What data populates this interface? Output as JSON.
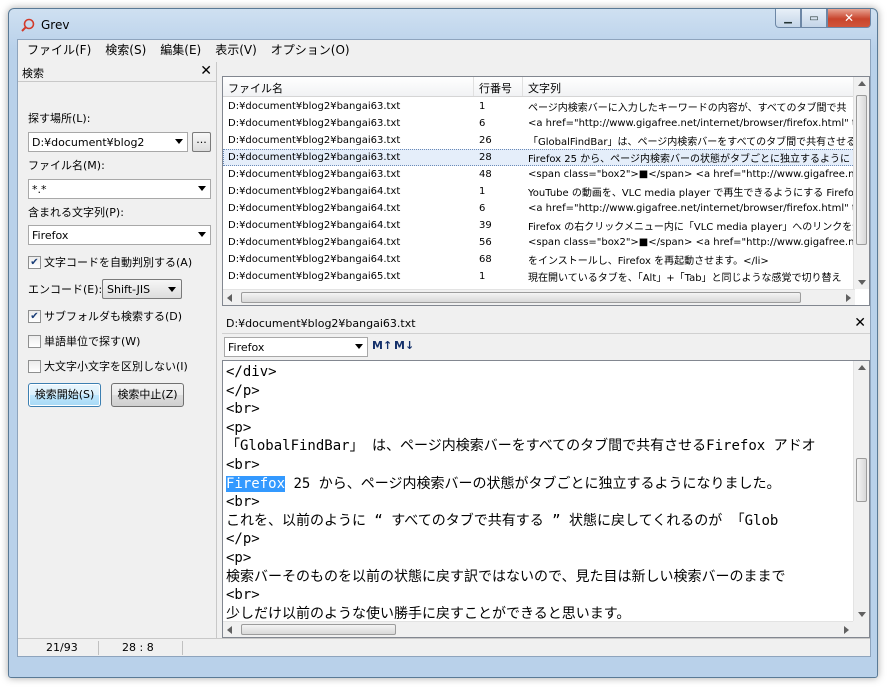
{
  "window": {
    "title": "Grev"
  },
  "menu": [
    "ファイル(F)",
    "検索(S)",
    "編集(E)",
    "表示(V)",
    "オプション(O)"
  ],
  "search_panel": {
    "title": "検索",
    "location_label": "探す場所(L):",
    "location_value": "D:¥document¥blog2",
    "browse_label": "...",
    "filename_label": "ファイル名(M):",
    "filename_value": "*.*",
    "text_label": "含まれる文字列(P):",
    "text_value": "Firefox",
    "autodetect_label": "文字コードを自動判別する(A)",
    "autodetect_checked": true,
    "encoding_label": "エンコード(E):",
    "encoding_value": "Shift-JIS",
    "subfolders_label": "サブフォルダも検索する(D)",
    "subfolders_checked": true,
    "wholeword_label": "単語単位で探す(W)",
    "wholeword_checked": false,
    "case_label": "大文字小文字を区別しない(I)",
    "case_checked": false,
    "start_button": "検索開始(S)",
    "stop_button": "検索中止(Z)"
  },
  "results": {
    "columns": [
      "ファイル名",
      "行番号",
      "文字列"
    ],
    "rows": [
      {
        "file": "D:¥document¥blog2¥bangai63.txt",
        "line": "1",
        "text": "ページ内検索バーに入力したキーワードの内容が、すべてのタブ間で共"
      },
      {
        "file": "D:¥document¥blog2¥bangai63.txt",
        "line": "6",
        "text": "<a href=\"http://www.gigafree.net/internet/browser/firefox.html\" t"
      },
      {
        "file": "D:¥document¥blog2¥bangai63.txt",
        "line": "26",
        "text": "「GlobalFindBar」は、ページ内検索バーをすべてのタブ間で共有させる"
      },
      {
        "file": "D:¥document¥blog2¥bangai63.txt",
        "line": "28",
        "text": "Firefox 25 から、ページ内検索バーの状態がタブごとに独立するように"
      },
      {
        "file": "D:¥document¥blog2¥bangai63.txt",
        "line": "48",
        "text": "<span class=\"box2\">■</span>  <a href=\"http://www.gigafree.n"
      },
      {
        "file": "D:¥document¥blog2¥bangai64.txt",
        "line": "1",
        "text": "YouTube の動画を、VLC media player で再生できるようにする Firefox"
      },
      {
        "file": "D:¥document¥blog2¥bangai64.txt",
        "line": "6",
        "text": "<a href=\"http://www.gigafree.net/internet/browser/firefox.html\" t"
      },
      {
        "file": "D:¥document¥blog2¥bangai64.txt",
        "line": "39",
        "text": "Firefox の右クリックメニュー内に「VLC media player」へのリンクを追加"
      },
      {
        "file": "D:¥document¥blog2¥bangai64.txt",
        "line": "56",
        "text": "<span class=\"box2\">■</span>  <a href=\"http://www.gigafree.n"
      },
      {
        "file": "D:¥document¥blog2¥bangai64.txt",
        "line": "68",
        "text": "をインストールし、Firefox を再起動させます。</li>"
      },
      {
        "file": "D:¥document¥blog2¥bangai65.txt",
        "line": "1",
        "text": "現在開いているタブを、「Alt」+「Tab」と同じような感覚で切り替え"
      }
    ],
    "selected_row": 3
  },
  "preview": {
    "path": "D:¥document¥blog2¥bangai63.txt",
    "find_value": "Firefox",
    "find_prev_label": "M↑",
    "find_next_label": "M↓",
    "highlight": "Firefox",
    "lines": [
      "</div>",
      "</p>",
      "<br>",
      "<p>",
      "「GlobalFindBar」 は、ページ内検索バーをすべてのタブ間で共有させるFirefox アドオ",
      "<br>",
      "Firefox 25 から、ページ内検索バーの状態がタブごとに独立するようになりました。",
      "<br>",
      "これを、以前のように “ すべてのタブで共有する ” 状態に戻してくれるのが 「Glob",
      "</p>",
      "<p>",
      "検索バーそのものを以前の状態に戻す訳ではないので、見た目は新しい検索バーのままで",
      "<br>",
      "少しだけ以前のような使い勝手に戻すことができると思います。",
      "</p>"
    ]
  },
  "status": {
    "count": "21/93",
    "position": "28 :    8"
  }
}
